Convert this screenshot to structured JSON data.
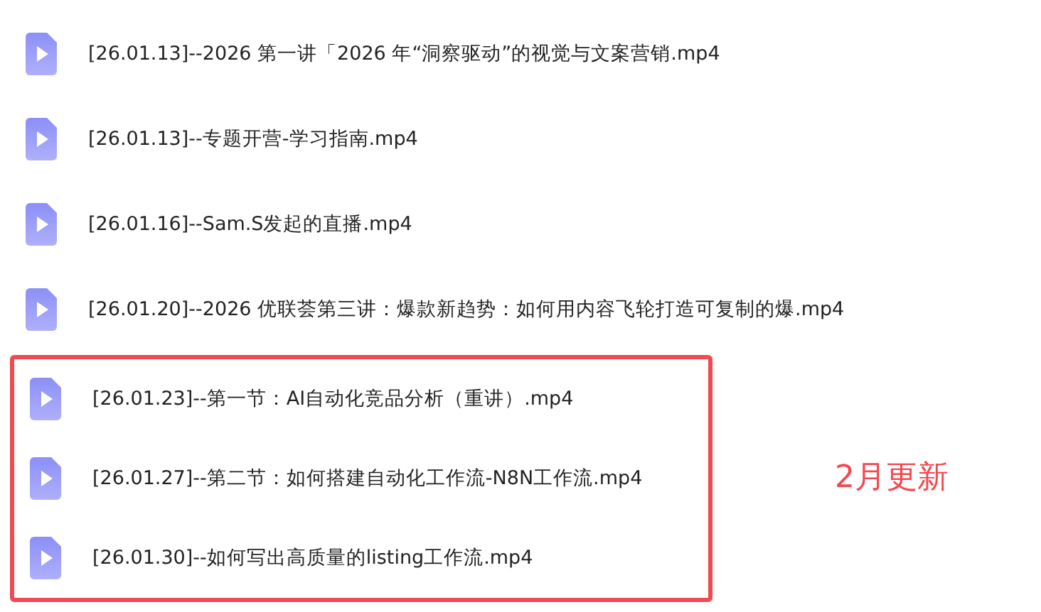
{
  "groups": [
    {
      "kind": "plain",
      "files": [
        {
          "name": "[26.01.13]--2026 第一讲「2026 年“洞察驱动”的视觉与文案营销.mp4"
        },
        {
          "name": "[26.01.13]--专题开营-学习指南.mp4"
        },
        {
          "name": "[26.01.16]--Sam.S发起的直播.mp4"
        },
        {
          "name": "[26.01.20]--2026 优联荟第三讲：爆款新趋势：如何用内容飞轮打造可复制的爆.mp4"
        }
      ]
    },
    {
      "kind": "highlighted",
      "note": "2月更新",
      "files": [
        {
          "name": "[26.01.23]--第一节：AI自动化竞品分析（重讲）.mp4"
        },
        {
          "name": "[26.01.27]--第二节：如何搭建自动化工作流-N8N工作流.mp4"
        },
        {
          "name": "[26.01.30]--如何写出高质量的listing工作流.mp4"
        }
      ]
    }
  ]
}
